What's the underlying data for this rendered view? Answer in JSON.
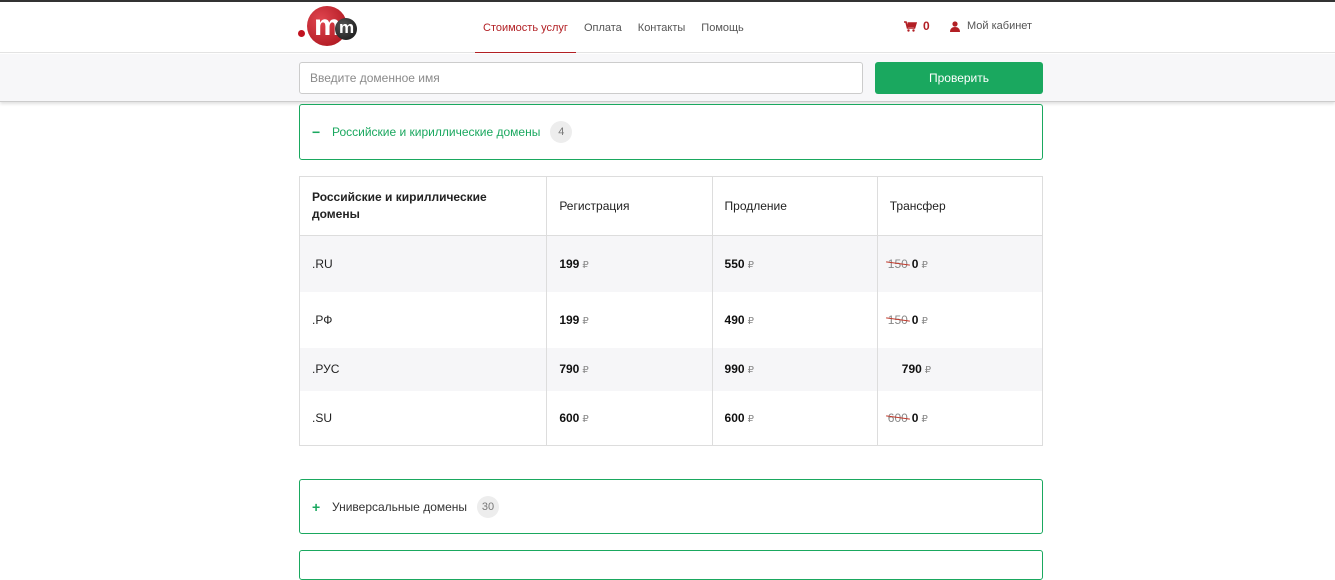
{
  "header": {
    "logo_text": "mastername",
    "nav": [
      "Стоимость услуг",
      "Оплата",
      "Контакты",
      "Помощь"
    ],
    "cart_count": "0",
    "cabinet_label": "Мой кабинет"
  },
  "search": {
    "placeholder": "Введите доменное имя",
    "button_label": "Проверить"
  },
  "sections": [
    {
      "label": "Российские и кириллические домены",
      "count": "4",
      "expanded": true
    },
    {
      "label": "Универсальные домены",
      "count": "30",
      "expanded": false
    }
  ],
  "table": {
    "headers": [
      "Российские и кириллические домены",
      "Регистрация",
      "Продление",
      "Трансфер"
    ],
    "currency": "₽",
    "rows": [
      {
        "zone": ".RU",
        "registration": "199",
        "renewal": "550",
        "transfer_old": "150",
        "transfer": "0"
      },
      {
        "zone": ".РФ",
        "registration": "199",
        "renewal": "490",
        "transfer_old": "150",
        "transfer": "0"
      },
      {
        "zone": ".РУС",
        "registration": "790",
        "renewal": "990",
        "transfer_old": "",
        "transfer": "790"
      },
      {
        "zone": ".SU",
        "registration": "600",
        "renewal": "600",
        "transfer_old": "600",
        "transfer": "0"
      }
    ]
  },
  "colors": {
    "accent": "#1aa85f",
    "brand": "#b21f24"
  }
}
